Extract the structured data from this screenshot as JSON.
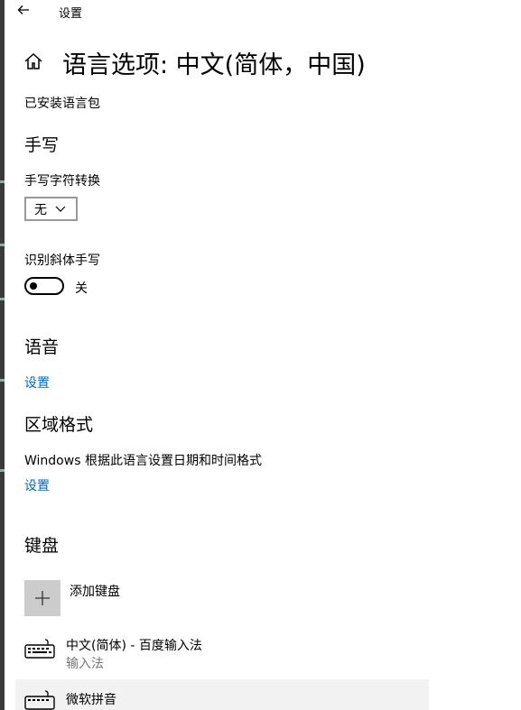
{
  "window": {
    "title": "设置"
  },
  "page": {
    "title": "语言选项: 中文(简体，中国)",
    "installed_pack_label": "已安装语言包"
  },
  "handwriting": {
    "heading": "手写",
    "conversion_label": "手写字符转换",
    "conversion_value": "无",
    "italic_label": "识别斜体手写",
    "italic_state": "关"
  },
  "speech": {
    "heading": "语音",
    "settings_link": "设置"
  },
  "region": {
    "heading": "区域格式",
    "description": "Windows 根据此语言设置日期和时间格式",
    "settings_link": "设置"
  },
  "keyboard": {
    "heading": "键盘",
    "add_label": "添加键盘",
    "items": [
      {
        "name": "中文(简体) - 百度输入法",
        "subtitle": "输入法"
      },
      {
        "name": "微软拼音",
        "subtitle": ""
      }
    ]
  },
  "icons": {
    "back": "back-arrow-icon",
    "home": "home-icon",
    "plus": "plus-icon",
    "keyboard": "keyboard-icon"
  }
}
